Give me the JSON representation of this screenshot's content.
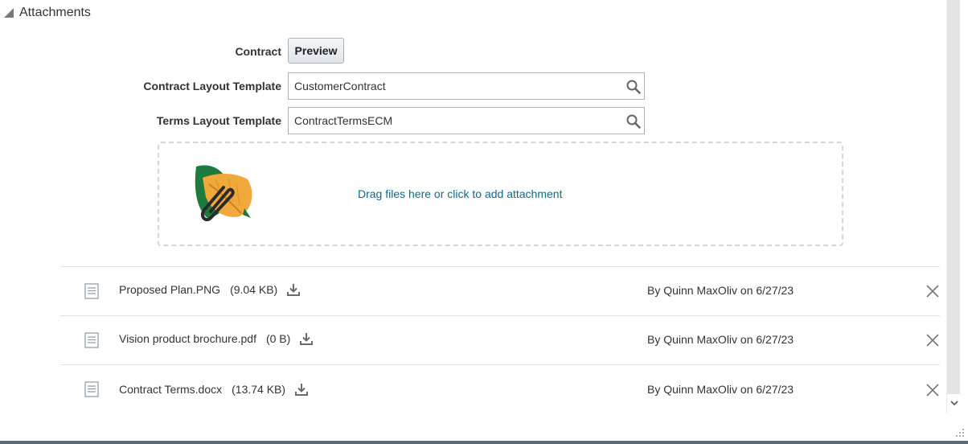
{
  "section": {
    "title": "Attachments"
  },
  "form": {
    "contract_label": "Contract",
    "preview_label": "Preview",
    "contract_layout_label": "Contract Layout Template",
    "contract_layout_value": "CustomerContract",
    "terms_layout_label": "Terms Layout Template",
    "terms_layout_value": "ContractTermsECM"
  },
  "dropzone": {
    "text": "Drag files here or click to add attachment"
  },
  "files": [
    {
      "name": "Proposed Plan.PNG",
      "size": "(9.04 KB)",
      "uploaded": "By Quinn MaxOliv on 6/27/23"
    },
    {
      "name": "Vision product brochure.pdf",
      "size": "(0 B)",
      "uploaded": "By Quinn MaxOliv on 6/27/23"
    },
    {
      "name": "Contract Terms.docx",
      "size": "(13.74 KB)",
      "uploaded": "By Quinn MaxOliv on 6/27/23"
    }
  ],
  "icons": {
    "collapse": "triangle-collapse-icon",
    "search": "search-icon",
    "attachment_illustration": "leaf-paperclip-icon",
    "file": "document-icon",
    "download": "download-icon",
    "delete": "close-icon",
    "scroll_down": "chevron-down-icon"
  },
  "colors": {
    "link": "#0e6b8c",
    "text": "#333333",
    "border": "#a8b2ba"
  }
}
